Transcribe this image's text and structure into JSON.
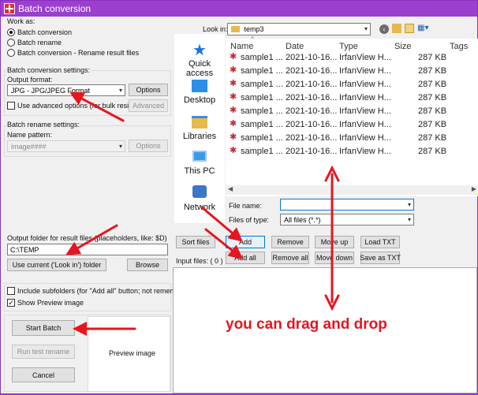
{
  "window": {
    "title": "Batch conversion"
  },
  "work_as": {
    "heading": "Work as:",
    "options": [
      "Batch conversion",
      "Batch rename",
      "Batch conversion - Rename result files"
    ]
  },
  "conversion": {
    "heading": "Batch conversion settings:",
    "output_format_label": "Output format:",
    "format_value": "JPG - JPG/JPEG Format",
    "options_button": "Options",
    "advanced_check": "Use advanced options (for bulk resize...)",
    "advanced_button": "Advanced"
  },
  "rename": {
    "heading": "Batch rename settings:",
    "pattern_label": "Name pattern:",
    "pattern_value": "image####",
    "options_button": "Options"
  },
  "output": {
    "label": "Output folder for result files (placeholders, like: $D)",
    "folder_value": "C:\\TEMP",
    "use_current_button": "Use current ('Look in') folder",
    "browse_button": "Browse"
  },
  "checks": {
    "include_subfolders": "Include subfolders (for \"Add all\" button; not remembered)",
    "show_preview": "Show Preview image"
  },
  "actions": {
    "start": "Start Batch",
    "run_test": "Run test rename",
    "cancel": "Cancel",
    "preview_label": "Preview image"
  },
  "browser": {
    "look_in_label": "Look in:",
    "look_in_value": "temp3",
    "places": [
      "Quick access",
      "Desktop",
      "Libraries",
      "This PC",
      "Network"
    ],
    "columns": [
      "Name",
      "Date",
      "Type",
      "Size",
      "Tags"
    ],
    "rows": [
      {
        "name": "sample1 ...",
        "date": "2021-10-16...",
        "type": "IrfanView H...",
        "size": "287 KB"
      },
      {
        "name": "sample1 ...",
        "date": "2021-10-16...",
        "type": "IrfanView H...",
        "size": "287 KB"
      },
      {
        "name": "sample1 ...",
        "date": "2021-10-16...",
        "type": "IrfanView H...",
        "size": "287 KB"
      },
      {
        "name": "sample1 ...",
        "date": "2021-10-16...",
        "type": "IrfanView H...",
        "size": "287 KB"
      },
      {
        "name": "sample1 ...",
        "date": "2021-10-16...",
        "type": "IrfanView H...",
        "size": "287 KB"
      },
      {
        "name": "sample1 ...",
        "date": "2021-10-16...",
        "type": "IrfanView H...",
        "size": "287 KB"
      },
      {
        "name": "sample1 ...",
        "date": "2021-10-16...",
        "type": "IrfanView H...",
        "size": "287 KB"
      },
      {
        "name": "sample1 ...",
        "date": "2021-10-16...",
        "type": "IrfanView H...",
        "size": "287 KB"
      }
    ],
    "file_name_label": "File name:",
    "file_name_value": "",
    "files_of_type_label": "Files of type:",
    "files_of_type_value": "All files (*.*)"
  },
  "file_buttons": {
    "sort": "Sort files",
    "add": "Add",
    "remove": "Remove",
    "move_up": "Move up",
    "load_txt": "Load TXT",
    "add_all": "Add all",
    "remove_all": "Remove all",
    "move_down": "Move down",
    "save_txt": "Save as TXT",
    "input_files": "Input files: ( 0 )"
  },
  "annotation": {
    "text": "you can drag and drop",
    "color": "#e8141e"
  }
}
